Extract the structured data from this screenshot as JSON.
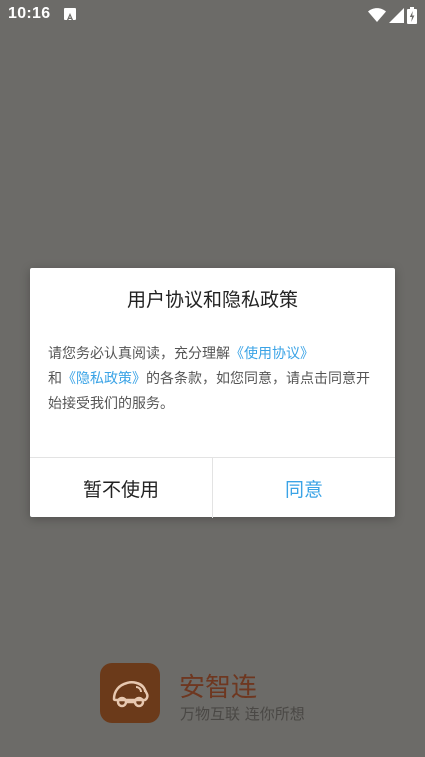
{
  "status_bar": {
    "time": "10:16",
    "notification_icon": "a-notification-icon",
    "wifi_icon": "wifi-icon",
    "signal_icon": "signal-icon",
    "battery_icon": "battery-charging-icon"
  },
  "dialog": {
    "title": "用户协议和隐私政策",
    "body": {
      "part1": "请您务必认真阅读，充分理解",
      "link_user_agreement": "《使用协议》",
      "part2": "和",
      "link_privacy_policy": "《隐私政策》",
      "part3": "的各条款，如您同意，请点击同意开始接受我们的服务。"
    },
    "decline_label": "暂不使用",
    "agree_label": "同意"
  },
  "splash": {
    "app_name": "安智连",
    "slogan": "万物互联  连你所想",
    "logo_icon": "car-connect-logo-icon"
  },
  "colors": {
    "link": "#3aa3e6",
    "scrim": "#6c6b68",
    "brand": "#6e3720"
  }
}
